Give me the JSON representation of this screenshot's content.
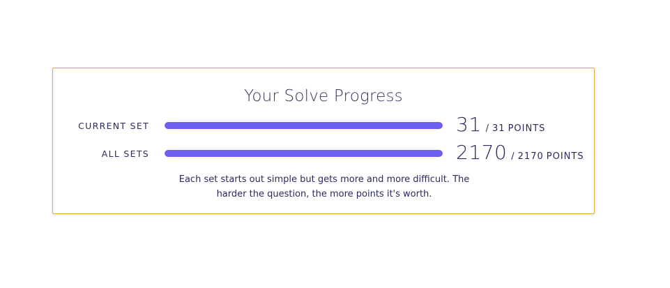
{
  "progress": {
    "title": "Your Solve Progress",
    "rows": [
      {
        "label": "CURRENT SET",
        "value": "31",
        "separator": "/",
        "total": "31",
        "unit": "POINTS",
        "fraction": 1.0
      },
      {
        "label": "ALL SETS",
        "value": "2170",
        "separator": "/",
        "total": "2170",
        "unit": "POINTS",
        "fraction": 1.0
      }
    ],
    "description": "Each set starts out simple but gets more and more difficult. The harder the question, the more points it's worth."
  },
  "colors": {
    "bar_fill": "#6c5ef0",
    "card_border": "#e3a93c",
    "text": "#2b2a5c"
  }
}
